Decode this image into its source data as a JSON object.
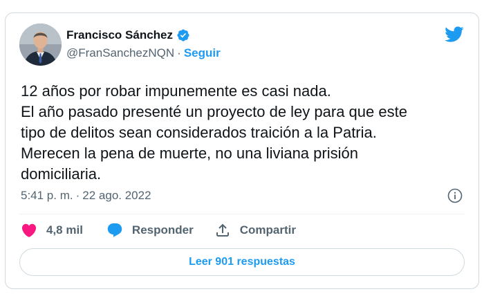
{
  "author": {
    "display_name": "Francisco Sánchez",
    "handle": "@FranSanchezNQN",
    "separator": "·",
    "follow_label": "Seguir",
    "verified_icon": "verified-badge-icon",
    "avatar_icon": "avatar"
  },
  "tweet": {
    "text": "12 años por robar impunemente es casi nada.\nEl año pasado presenté un proyecto de ley para que este\ntipo de delitos sean considerados traición a la Patria.\nMerecen la pena de muerte, no una liviana prisión\ndomiciliaria.",
    "time": "5:41 p. m.",
    "separator": "·",
    "date": "22 ago. 2022"
  },
  "actions": {
    "likes_count": "4,8 mil",
    "reply_label": "Responder",
    "share_label": "Compartir",
    "read_replies_label": "Leer 901 respuestas"
  },
  "colors": {
    "accent": "#1d9bf0",
    "heart": "#f91880",
    "text_primary": "#0f1419",
    "text_secondary": "#536471",
    "border": "#cfd9de"
  }
}
